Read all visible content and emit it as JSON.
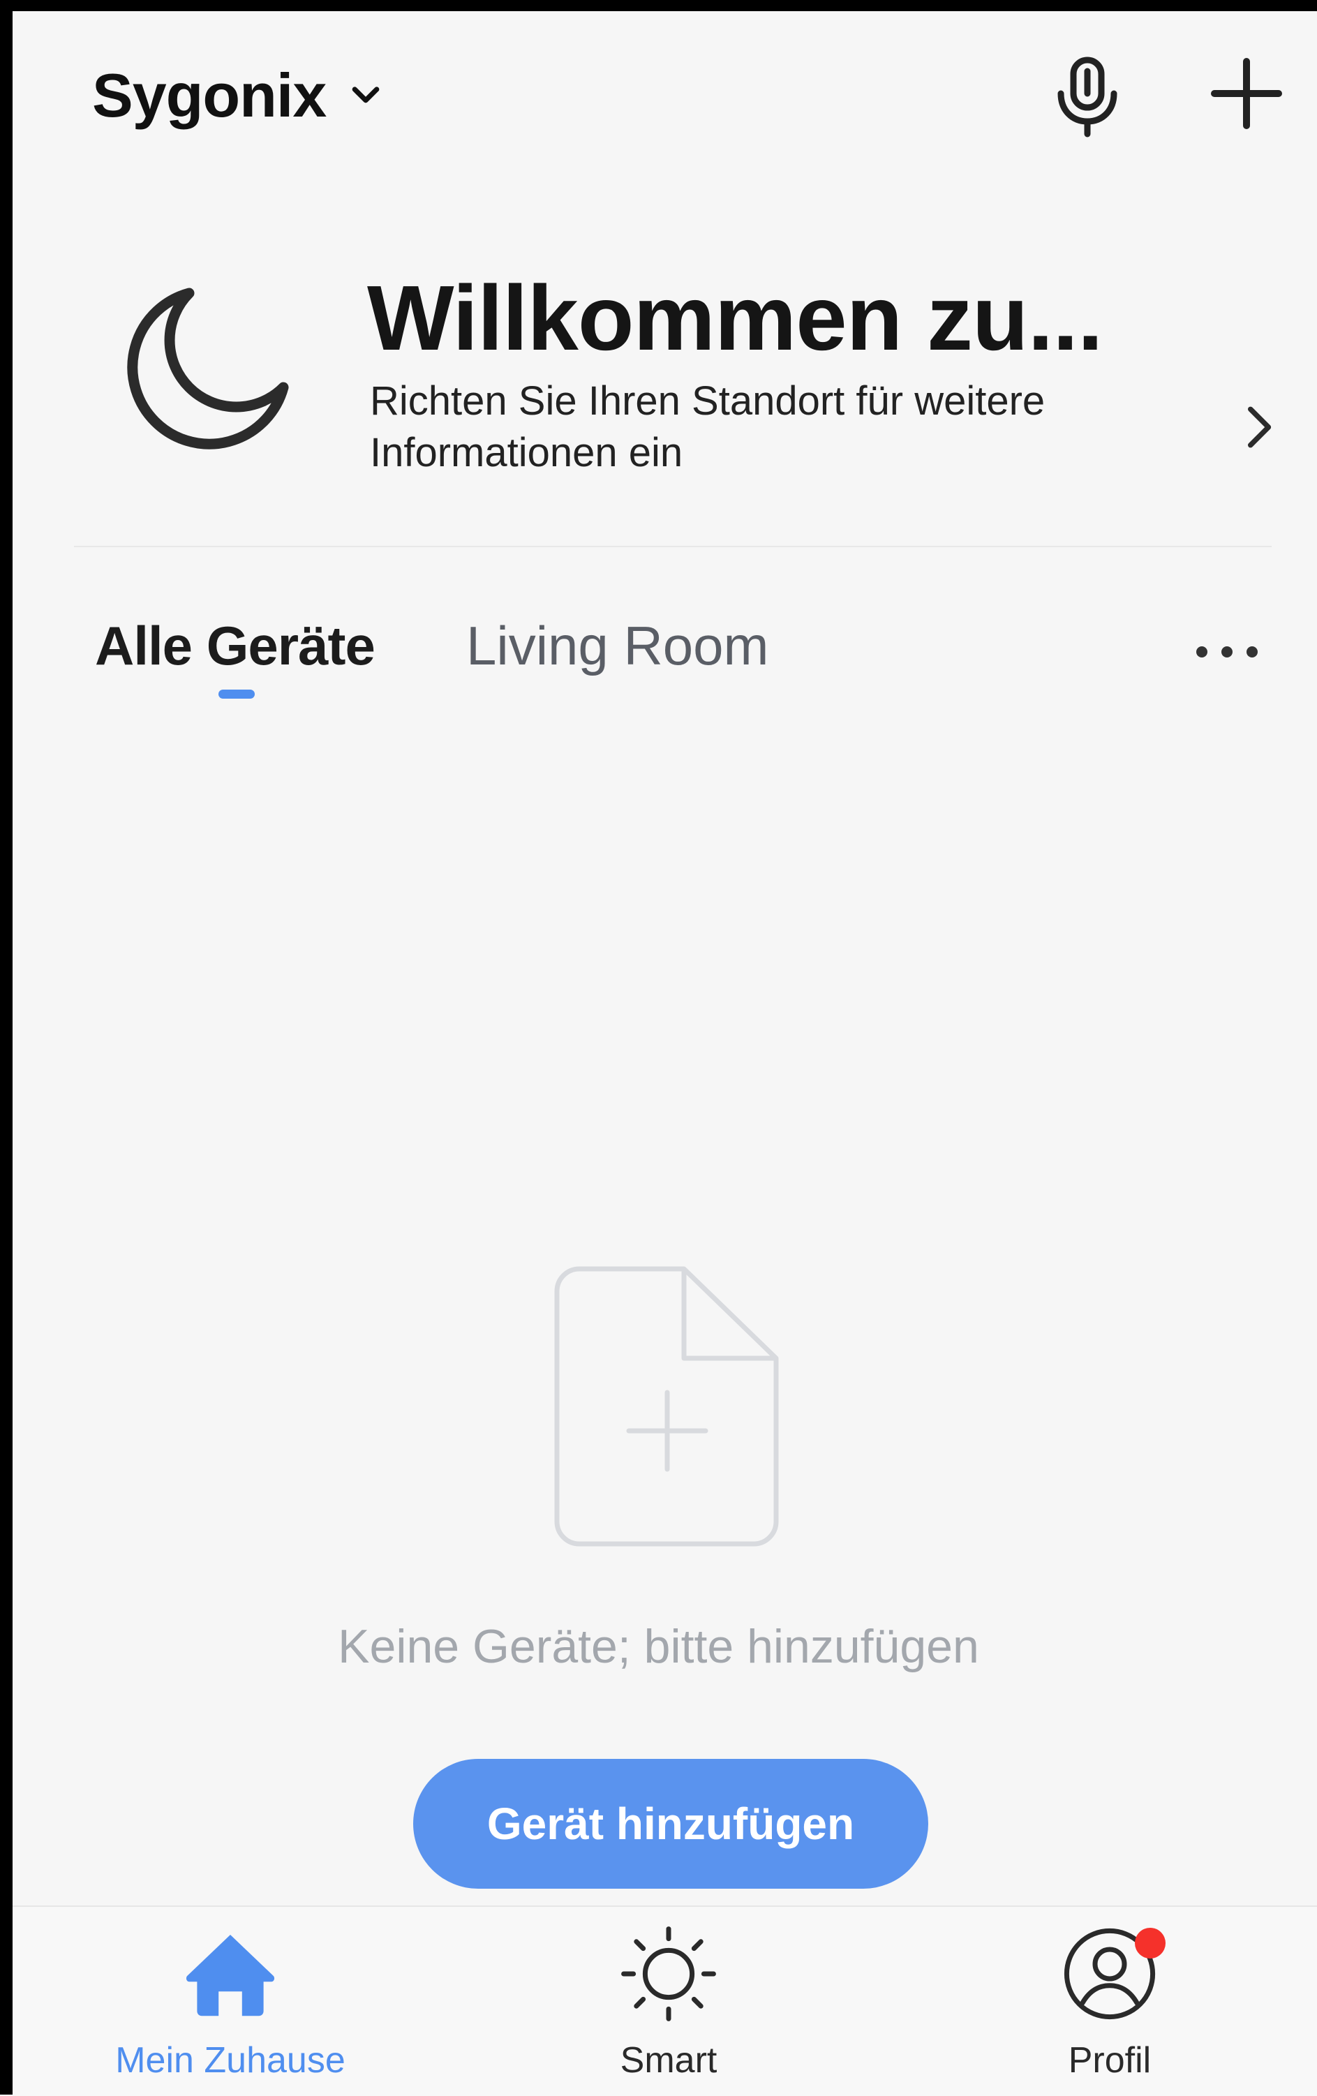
{
  "header": {
    "home_name": "Sygonix",
    "icons": {
      "dropdown": "chevron-down-icon",
      "voice": "microphone-icon",
      "add": "plus-icon"
    }
  },
  "welcome": {
    "title": "Willkommen zu...",
    "subtitle": "Richten Sie Ihren Standort für weitere Informationen ein",
    "icons": {
      "weather": "moon-icon",
      "arrow": "chevron-right-icon"
    }
  },
  "tabs": {
    "items": [
      {
        "label": "Alle Geräte",
        "active": true
      },
      {
        "label": "Living Room",
        "active": false
      }
    ],
    "more_icon": "more-horizontal-icon"
  },
  "empty_state": {
    "icon": "add-document-icon",
    "message": "Keine Geräte; bitte hinzufügen",
    "button_label": "Gerät hinzufügen"
  },
  "bottom_nav": {
    "items": [
      {
        "label": "Mein Zuhause",
        "icon": "home-icon",
        "active": true
      },
      {
        "label": "Smart",
        "icon": "sun-icon",
        "active": false
      },
      {
        "label": "Profil",
        "icon": "profile-icon",
        "active": false,
        "notification_dot": true
      }
    ]
  },
  "colors": {
    "accent": "#4f8eef",
    "button": "#5a93ee",
    "background": "#f6f6f6",
    "notification": "#f5312b",
    "muted_text": "#a3a7ad"
  }
}
